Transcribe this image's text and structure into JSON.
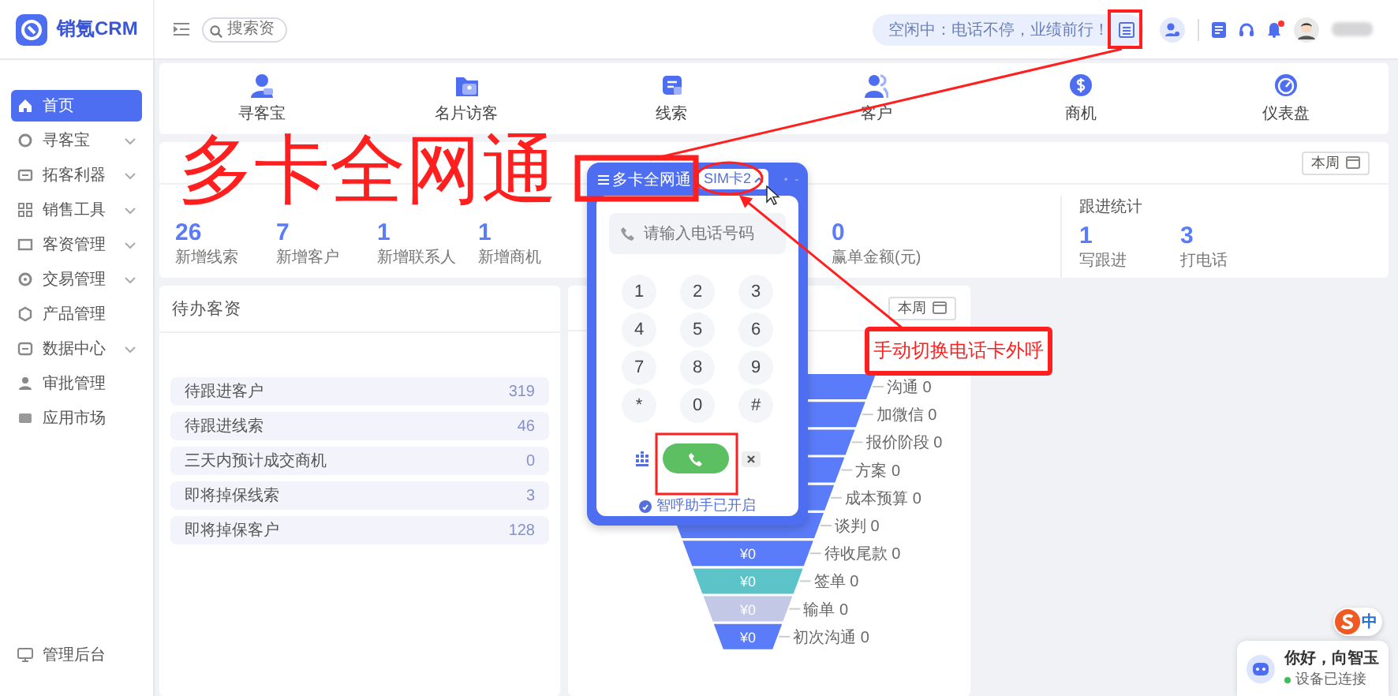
{
  "header": {
    "brand": "销氪CRM",
    "search": {
      "placeholder": "搜索资"
    },
    "status": "空闲中：电话不停，业绩前行！",
    "notification": true
  },
  "sidebar": {
    "items": [
      {
        "label": "首页",
        "selected": true,
        "expandable": false
      },
      {
        "label": "寻客宝",
        "selected": false,
        "expandable": true
      },
      {
        "label": "拓客利器",
        "selected": false,
        "expandable": true
      },
      {
        "label": "销售工具",
        "selected": false,
        "expandable": true
      },
      {
        "label": "客资管理",
        "selected": false,
        "expandable": true
      },
      {
        "label": "交易管理",
        "selected": false,
        "expandable": true
      },
      {
        "label": "产品管理",
        "selected": false,
        "expandable": false
      },
      {
        "label": "数据中心",
        "selected": false,
        "expandable": true
      },
      {
        "label": "审批管理",
        "selected": false,
        "expandable": false
      },
      {
        "label": "应用市场",
        "selected": false,
        "expandable": false
      }
    ],
    "footer": "管理后台"
  },
  "quick_links": [
    "寻客宝",
    "名片访客",
    "线索",
    "客户",
    "商机",
    "仪表盘"
  ],
  "dashboard": {
    "period": "本周",
    "sales": {
      "stats": [
        {
          "value": "26",
          "label": "新增线索"
        },
        {
          "value": "7",
          "label": "新增客户"
        },
        {
          "value": "1",
          "label": "新增联系人"
        },
        {
          "value": "1",
          "label": "新增商机"
        },
        {
          "value": "0",
          "label": "赢单金额(元)"
        }
      ]
    },
    "followup": {
      "title": "跟进统计",
      "stats": [
        {
          "value": "1",
          "label": "写跟进"
        },
        {
          "value": "3",
          "label": "打电话"
        }
      ]
    }
  },
  "todo": {
    "title": "待办客资",
    "rows": [
      {
        "label": "待跟进客户",
        "count": "319"
      },
      {
        "label": "待跟进线索",
        "count": "46"
      },
      {
        "label": "三天内预计成交商机",
        "count": "0"
      },
      {
        "label": "即将掉保线索",
        "count": "3"
      },
      {
        "label": "即将掉保客户",
        "count": "128"
      }
    ]
  },
  "funnel": {
    "period": "本周",
    "stages": [
      {
        "label": "沟通 0",
        "color": "#5b7cfa"
      },
      {
        "label": "加微信 0",
        "color": "#5b7cfa"
      },
      {
        "label": "报价阶段 0",
        "color": "#5b7cfa"
      },
      {
        "label": "方案 0",
        "color": "#5b7cfa"
      },
      {
        "label": "成本预算 0",
        "color": "#5b7cfa"
      },
      {
        "label": "谈判 0",
        "color": "#5b7cfa"
      },
      {
        "label": "待收尾款 0",
        "color": "#5b7cfa",
        "value": "¥0"
      },
      {
        "label": "签单 0",
        "color": "#5cc4c9",
        "value": "¥0"
      },
      {
        "label": "输单 0",
        "color": "#c3c8e6",
        "value": "¥0"
      },
      {
        "label": "初次沟通 0",
        "color": "#5b7cfa",
        "value": "¥0"
      }
    ]
  },
  "dialer": {
    "title": "多卡全网通",
    "sim": "SIM卡2",
    "placeholder": "请输入电话号码",
    "keys": [
      "1",
      "2",
      "3",
      "4",
      "5",
      "6",
      "7",
      "8",
      "9",
      "*",
      "0",
      "#"
    ],
    "footer": "智呼助手已开启"
  },
  "helper": {
    "greeting": "你好，向智玉",
    "status": "设备已连接",
    "ime": "中"
  },
  "annotations": {
    "headline": "多卡全网通",
    "callout": "手动切换电话卡外呼"
  }
}
